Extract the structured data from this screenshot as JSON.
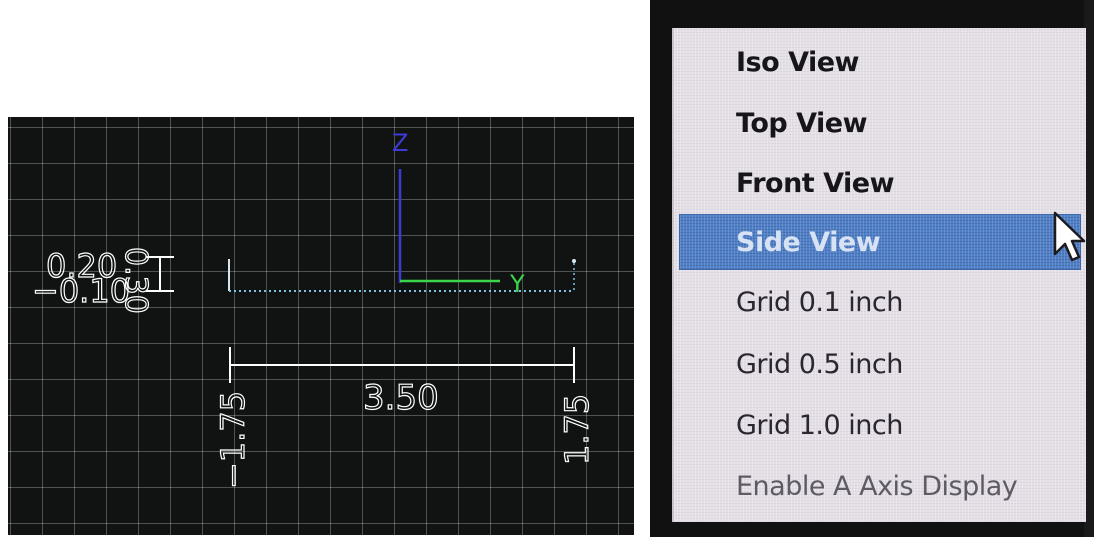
{
  "preview": {
    "axes": {
      "z_label": "Z",
      "y_label": "Y",
      "z_color": "#3b3bd6",
      "y_color": "#3ad64a"
    },
    "height_dims": {
      "top": "0.20",
      "bottom": "−0.10",
      "span": "0.30"
    },
    "width_dims": {
      "total": "3.50",
      "left": "−1.75",
      "right": "1.75"
    }
  },
  "menu": {
    "items": [
      {
        "label": "Iso View",
        "style": "bold"
      },
      {
        "label": "Top View",
        "style": "bold"
      },
      {
        "label": "Front View",
        "style": "bold"
      },
      {
        "label": "Side View",
        "style": "highlighted"
      },
      {
        "label": "Grid 0.1 inch",
        "style": "normal"
      },
      {
        "label": "Grid 0.5 inch",
        "style": "normal"
      },
      {
        "label": "Grid 1.0 inch",
        "style": "normal"
      },
      {
        "label": "Enable A Axis Display",
        "style": "faded"
      }
    ],
    "highlight_color": "#4f7fc6",
    "cursor_icon": "arrow-cursor-icon"
  }
}
